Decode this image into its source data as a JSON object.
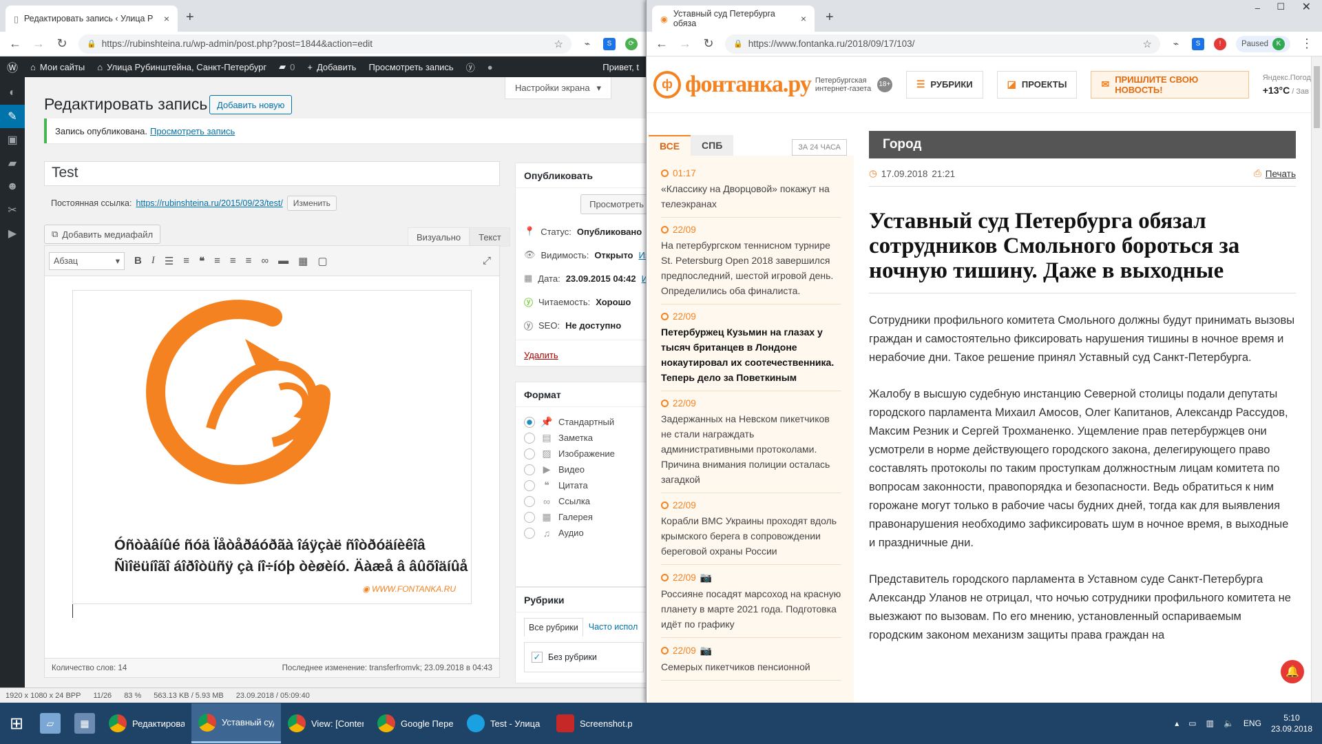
{
  "left_window": {
    "tab_title": "Редактировать запись ‹ Улица Р",
    "url": "https://rubinshteina.ru/wp-admin/post.php?post=1844&action=edit",
    "adminbar": {
      "my_sites": "Мои сайты",
      "site_name": "Улица Рубинштейна, Санкт-Петербург",
      "comments": "0",
      "add": "Добавить",
      "view_post": "Просмотреть запись",
      "greeting": "Привет, t"
    },
    "screen_options": "Настройки экрана",
    "page_title": "Редактировать запись",
    "add_new": "Добавить новую",
    "notice": "Запись опубликована.",
    "notice_link": "Просмотреть запись",
    "post_title": "Test",
    "permalink_label": "Постоянная ссылка:",
    "permalink_url": "https://rubinshteina.ru/2015/09/23/test/",
    "permalink_edit": "Изменить",
    "add_media": "Добавить медиафайл",
    "tab_visual": "Визуально",
    "tab_text": "Текст",
    "format_select": "Абзац",
    "garbled_line1": "Óñòàâíûé ñóä Ïåòåðáóðãà îáÿçàë ñîòðóäíèêîâ",
    "garbled_line2": "Ñìîëüíîãî áîðîòüñÿ çà íî÷íóþ òèøèíó. Äàæå â âûõîäíûå",
    "watermark": "WWW.FONTANKA.RU",
    "word_count": "Количество слов: 14",
    "last_edit": "Последнее изменение: transferfromvk; 23.09.2018 в 04:43",
    "publish": {
      "heading": "Опубликовать",
      "preview": "Просмотреть",
      "status_label": "Статус:",
      "status_value": "Опубликовано",
      "visibility_label": "Видимость:",
      "visibility_value": "Открыто",
      "date_label": "Дата:",
      "date_value": "23.09.2015 04:42",
      "edit_short": "Изм",
      "readability_label": "Читаемость:",
      "readability_value": "Хорошо",
      "seo_label": "SEO:",
      "seo_value": "Не доступно",
      "delete": "Удалить"
    },
    "format_box": {
      "heading": "Формат",
      "options": [
        "Стандартный",
        "Заметка",
        "Изображение",
        "Видео",
        "Цитата",
        "Ссылка",
        "Галерея",
        "Аудио"
      ],
      "icons": [
        "pin-icon",
        "note-icon",
        "image-icon",
        "video-icon",
        "quote-icon",
        "link-icon",
        "gallery-icon",
        "audio-icon"
      ],
      "selected": 0
    },
    "categories_box": {
      "heading": "Рубрики",
      "tab_all": "Все рубрики",
      "tab_popular": "Часто испол",
      "item": "Без рубрики"
    },
    "image_viewer_status": [
      "1920 x 1080 x 24 BPP",
      "11/26",
      "83 %",
      "563.13 KB / 5.93 MB",
      "23.09.2018 / 05:09:40"
    ]
  },
  "right_window": {
    "tab_title": "Уставный суд Петербурга обяза",
    "url": "https://www.fontanka.ru/2018/09/17/103/",
    "paused": "Paused",
    "profile_initial": "K",
    "site": {
      "logo": "фонтанка.ру",
      "logo_sub": "Петербургская интернет-газета",
      "age": "18+",
      "btn_rubrics": "РУБРИКИ",
      "btn_projects": "ПРОЕКТЫ",
      "btn_news": "ПРИШЛИТЕ СВОЮ НОВОСТЬ!",
      "weather_src": "Яндекс.Погода",
      "temp": "+13°C",
      "tomorrow": "/ Зав"
    },
    "feed": {
      "tab_all": "ВСЕ",
      "tab_spb": "СПБ",
      "tab_24": "ЗА 24 ЧАСА",
      "items": [
        {
          "time": "01:17",
          "text": "«Классику на Дворцовой» покажут на телеэкранах",
          "bold": false,
          "camera": false
        },
        {
          "time": "22/09",
          "text": "На петербургском теннисном турнире St. Petersburg Open 2018 завершился предпоследний, шестой игровой день. Определились оба финалиста.",
          "bold": false,
          "camera": false
        },
        {
          "time": "22/09",
          "text": "Петербуржец Кузьмин на глазах у тысяч британцев в Лондоне нокаутировал их соотечественника. Теперь дело за Поветкиным",
          "bold": true,
          "camera": false
        },
        {
          "time": "22/09",
          "text": "Задержанных на Невском пикетчиков не стали награждать административными протоколами. Причина внимания полиции осталась загадкой",
          "bold": false,
          "camera": false
        },
        {
          "time": "22/09",
          "text": "Корабли ВМС Украины проходят вдоль крымского берега в сопровождении береговой охраны России",
          "bold": false,
          "camera": false
        },
        {
          "time": "22/09",
          "text": "Россияне посадят марсоход на красную планету в марте 2021 года. Подготовка идёт по графику",
          "bold": false,
          "camera": true
        },
        {
          "time": "22/09",
          "text": "Семерых пикетчиков пенсионной",
          "bold": false,
          "camera": true
        }
      ]
    },
    "article": {
      "rubric": "Город",
      "date": "17.09.2018",
      "time": "21:21",
      "print": "Печать",
      "title": "Уставный суд Петербурга обязал сотрудников Смольного бороться за ночную тишину. Даже в выходные",
      "paragraphs": [
        "Сотрудники профильного комитета Смольного должны будут принимать вызовы граждан и самостоятельно фиксировать нарушения тишины в ночное время и нерабочие дни. Такое решение принял Уставный суд Санкт-Петербурга.",
        "Жалобу в высшую судебную инстанцию Северной столицы подали депутаты городского парламента Михаил Амосов, Олег Капитанов, Александр Рассудов, Максим Резник и Сергей Трохманенко. Ущемление прав петербуржцев они усмотрели в норме действующего городского закона, делегирующего право составлять протоколы по таким проступкам должностным лицам комитета по вопросам законности, правопорядка и безопасности. Ведь обратиться к ним горожане могут только в рабочие часы будних дней, тогда как для выявления правонарушения необходимо зафиксировать шум в ночное время, в выходные и праздничные дни.",
        "Представитель городского парламента в Уставном суде Санкт-Петербурга Александр Уланов не отрицал, что ночью сотрудники профильного комитета не выезжают по вызовам. По его мнению, установленный оспариваемым городским законом механизм защиты права граждан на"
      ]
    }
  },
  "taskbar": {
    "items": [
      {
        "label": "Редактировать за...",
        "icon": "chrome-icon"
      },
      {
        "label": "Уставный суд Пе...",
        "icon": "chrome-icon"
      },
      {
        "label": "View: [Content Ca...",
        "icon": "chrome-icon"
      },
      {
        "label": "Google Переводч...",
        "icon": "chrome-icon"
      },
      {
        "label": "Test - Улица Руб...",
        "icon": "ie-icon"
      },
      {
        "label": "Screenshot.png - ...",
        "icon": "irfanview-icon"
      }
    ],
    "lang": "ENG",
    "time": "5:10",
    "date": "23.09.2018"
  }
}
